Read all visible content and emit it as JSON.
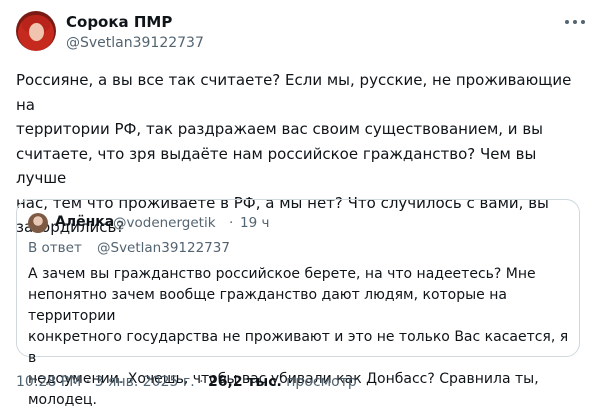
{
  "author": {
    "name": "Сорока ПМР",
    "handle": "@Svetlan39122737"
  },
  "tweet": {
    "text": "Россияне, а вы все так считаете? Если мы, русские, не проживающие на\nтерритории РФ, так раздражаем вас своим существованием, и вы\nсчитаете, что зря выдаёте нам российское гражданство? Чем вы лучше\nнас, тем что проживаете в РФ, а мы нет? Что случилось с вами, вы\nзагордились?"
  },
  "quote": {
    "name": "Алёнка",
    "handle": "@vodenergetik",
    "separator": "·",
    "time": "19 ч",
    "reply_prefix": "В ответ",
    "reply_handle": "@Svetlan39122737",
    "text": "А зачем вы гражданство российское берете, на что надеетесь? Мне\nнепонятно зачем вообще гражданство дают людям, которые на территории\nконкретного государства не проживают и это не только Вас касается, я в\nнедоумении. Хочешь, чтобы вас убивали как Донбасс? Сравнила ты, молодец."
  },
  "meta": {
    "time": "10:28 PM",
    "separator": "·",
    "date": "3 янв. 2025 г.",
    "views_count": "26,2 тыс.",
    "views_label": "просмотр"
  },
  "icons": [
    "more-icon"
  ]
}
